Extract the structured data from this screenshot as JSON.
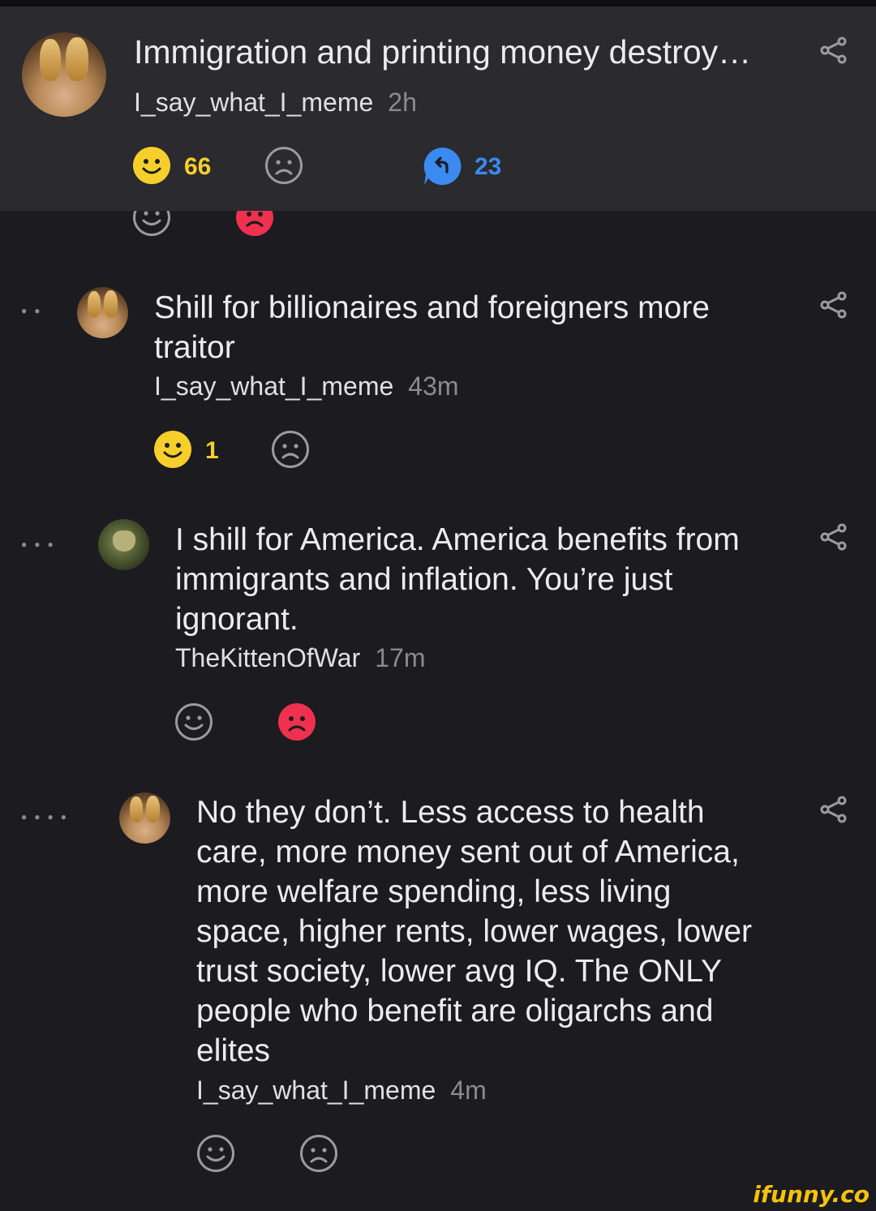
{
  "post": {
    "title": "Immigration and printing money destroy…",
    "author": "I_say_what_I_meme",
    "time": "2h",
    "smile_count": "66",
    "reply_count": "23"
  },
  "comments": [
    {
      "text": "Shill for billionaires and foreigners more traitor",
      "author": "I_say_what_I_meme",
      "time": "43m",
      "smile_count": "1"
    },
    {
      "text": "I shill for America. America benefits from immigrants and inflation. You’re just ignorant.",
      "author": "TheKittenOfWar",
      "time": "17m"
    },
    {
      "text": "No they don’t. Less access to health care, more money sent out of America, more welfare spending, less living space, higher rents, lower wages, lower trust society, lower avg IQ. The ONLY people who benefit are oligarchs and elites",
      "author": "I_say_what_I_meme",
      "time": "4m"
    }
  ],
  "watermark": "ifunny.co",
  "colors": {
    "background": "#1b1b20",
    "header": "#2a2a2f",
    "smile_active": "#f7cf2a",
    "frown_active": "#f0304f",
    "reply": "#3a8af0"
  },
  "icons": [
    "share-icon",
    "smile-icon",
    "frown-icon",
    "reply-icon"
  ]
}
